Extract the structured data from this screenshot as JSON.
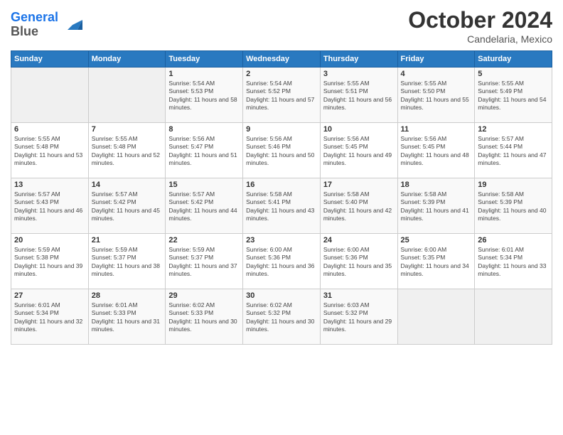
{
  "header": {
    "logo_line1": "General",
    "logo_line2": "Blue",
    "month": "October 2024",
    "location": "Candelaria, Mexico"
  },
  "weekdays": [
    "Sunday",
    "Monday",
    "Tuesday",
    "Wednesday",
    "Thursday",
    "Friday",
    "Saturday"
  ],
  "weeks": [
    [
      {
        "day": "",
        "empty": true
      },
      {
        "day": "",
        "empty": true
      },
      {
        "day": "1",
        "sunrise": "5:54 AM",
        "sunset": "5:53 PM",
        "daylight": "11 hours and 58 minutes."
      },
      {
        "day": "2",
        "sunrise": "5:54 AM",
        "sunset": "5:52 PM",
        "daylight": "11 hours and 57 minutes."
      },
      {
        "day": "3",
        "sunrise": "5:55 AM",
        "sunset": "5:51 PM",
        "daylight": "11 hours and 56 minutes."
      },
      {
        "day": "4",
        "sunrise": "5:55 AM",
        "sunset": "5:50 PM",
        "daylight": "11 hours and 55 minutes."
      },
      {
        "day": "5",
        "sunrise": "5:55 AM",
        "sunset": "5:49 PM",
        "daylight": "11 hours and 54 minutes."
      }
    ],
    [
      {
        "day": "6",
        "sunrise": "5:55 AM",
        "sunset": "5:48 PM",
        "daylight": "11 hours and 53 minutes."
      },
      {
        "day": "7",
        "sunrise": "5:55 AM",
        "sunset": "5:48 PM",
        "daylight": "11 hours and 52 minutes."
      },
      {
        "day": "8",
        "sunrise": "5:56 AM",
        "sunset": "5:47 PM",
        "daylight": "11 hours and 51 minutes."
      },
      {
        "day": "9",
        "sunrise": "5:56 AM",
        "sunset": "5:46 PM",
        "daylight": "11 hours and 50 minutes."
      },
      {
        "day": "10",
        "sunrise": "5:56 AM",
        "sunset": "5:45 PM",
        "daylight": "11 hours and 49 minutes."
      },
      {
        "day": "11",
        "sunrise": "5:56 AM",
        "sunset": "5:45 PM",
        "daylight": "11 hours and 48 minutes."
      },
      {
        "day": "12",
        "sunrise": "5:57 AM",
        "sunset": "5:44 PM",
        "daylight": "11 hours and 47 minutes."
      }
    ],
    [
      {
        "day": "13",
        "sunrise": "5:57 AM",
        "sunset": "5:43 PM",
        "daylight": "11 hours and 46 minutes."
      },
      {
        "day": "14",
        "sunrise": "5:57 AM",
        "sunset": "5:42 PM",
        "daylight": "11 hours and 45 minutes."
      },
      {
        "day": "15",
        "sunrise": "5:57 AM",
        "sunset": "5:42 PM",
        "daylight": "11 hours and 44 minutes."
      },
      {
        "day": "16",
        "sunrise": "5:58 AM",
        "sunset": "5:41 PM",
        "daylight": "11 hours and 43 minutes."
      },
      {
        "day": "17",
        "sunrise": "5:58 AM",
        "sunset": "5:40 PM",
        "daylight": "11 hours and 42 minutes."
      },
      {
        "day": "18",
        "sunrise": "5:58 AM",
        "sunset": "5:39 PM",
        "daylight": "11 hours and 41 minutes."
      },
      {
        "day": "19",
        "sunrise": "5:58 AM",
        "sunset": "5:39 PM",
        "daylight": "11 hours and 40 minutes."
      }
    ],
    [
      {
        "day": "20",
        "sunrise": "5:59 AM",
        "sunset": "5:38 PM",
        "daylight": "11 hours and 39 minutes."
      },
      {
        "day": "21",
        "sunrise": "5:59 AM",
        "sunset": "5:37 PM",
        "daylight": "11 hours and 38 minutes."
      },
      {
        "day": "22",
        "sunrise": "5:59 AM",
        "sunset": "5:37 PM",
        "daylight": "11 hours and 37 minutes."
      },
      {
        "day": "23",
        "sunrise": "6:00 AM",
        "sunset": "5:36 PM",
        "daylight": "11 hours and 36 minutes."
      },
      {
        "day": "24",
        "sunrise": "6:00 AM",
        "sunset": "5:36 PM",
        "daylight": "11 hours and 35 minutes."
      },
      {
        "day": "25",
        "sunrise": "6:00 AM",
        "sunset": "5:35 PM",
        "daylight": "11 hours and 34 minutes."
      },
      {
        "day": "26",
        "sunrise": "6:01 AM",
        "sunset": "5:34 PM",
        "daylight": "11 hours and 33 minutes."
      }
    ],
    [
      {
        "day": "27",
        "sunrise": "6:01 AM",
        "sunset": "5:34 PM",
        "daylight": "11 hours and 32 minutes."
      },
      {
        "day": "28",
        "sunrise": "6:01 AM",
        "sunset": "5:33 PM",
        "daylight": "11 hours and 31 minutes."
      },
      {
        "day": "29",
        "sunrise": "6:02 AM",
        "sunset": "5:33 PM",
        "daylight": "11 hours and 30 minutes."
      },
      {
        "day": "30",
        "sunrise": "6:02 AM",
        "sunset": "5:32 PM",
        "daylight": "11 hours and 30 minutes."
      },
      {
        "day": "31",
        "sunrise": "6:03 AM",
        "sunset": "5:32 PM",
        "daylight": "11 hours and 29 minutes."
      },
      {
        "day": "",
        "empty": true
      },
      {
        "day": "",
        "empty": true
      }
    ]
  ]
}
